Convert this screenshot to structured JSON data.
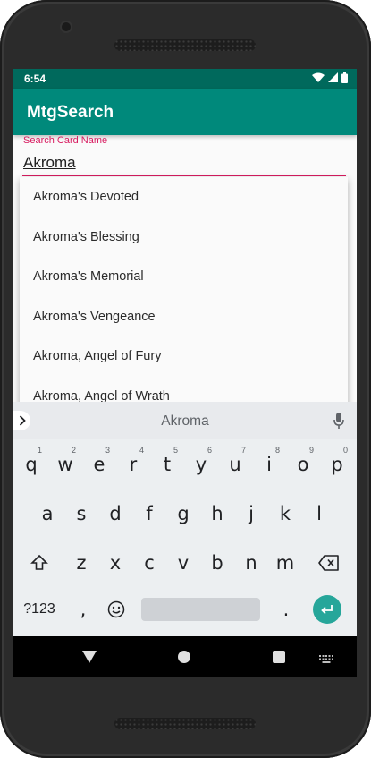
{
  "status": {
    "time": "6:54"
  },
  "app": {
    "title": "MtgSearch"
  },
  "search": {
    "label": "Search Card Name",
    "value": "Akroma"
  },
  "suggestions": [
    "Akroma's Devoted",
    "Akroma's Blessing",
    "Akroma's Memorial",
    "Akroma's Vengeance",
    "Akroma, Angel of Fury",
    "Akroma, Angel of Wrath"
  ],
  "keyboard": {
    "suggestion": "Akroma",
    "row1": [
      "q",
      "w",
      "e",
      "r",
      "t",
      "y",
      "u",
      "i",
      "o",
      "p"
    ],
    "row1_hints": [
      "1",
      "2",
      "3",
      "4",
      "5",
      "6",
      "7",
      "8",
      "9",
      "0"
    ],
    "row2": [
      "a",
      "s",
      "d",
      "f",
      "g",
      "h",
      "j",
      "k",
      "l"
    ],
    "row3": [
      "z",
      "x",
      "c",
      "v",
      "b",
      "n",
      "m"
    ],
    "symbols_label": "?123",
    "comma": ",",
    "period": "."
  },
  "colors": {
    "status_bar": "#00695c",
    "app_bar": "#00897b",
    "accent": "#d81b60",
    "enter_key": "#26a69a"
  },
  "icons": [
    "wifi-icon",
    "cell-signal-icon",
    "battery-icon",
    "chevron-right-icon",
    "mic-icon",
    "shift-icon",
    "backspace-icon",
    "emoji-icon",
    "enter-icon",
    "back-icon",
    "home-icon",
    "recents-icon",
    "keyboard-icon"
  ]
}
